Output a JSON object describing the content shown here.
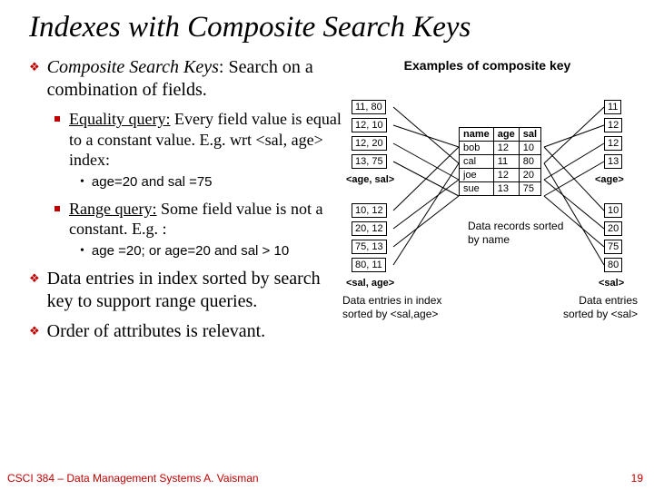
{
  "title": "Indexes with Composite Search Keys",
  "bullets": {
    "b1a_em": "Composite Search Keys",
    "b1a_rest": ": Search on a combination of fields.",
    "b2a_u": "Equality query:",
    "b2a_rest": " Every field value is equal to a constant value. E.g. wrt <sal, age> index:",
    "b3a": "age=20 and sal =75",
    "b2b_u": "Range query:",
    "b2b_rest": " Some field value is not a constant. E.g. :",
    "b3b": "age =20; or age=20 and sal > 10",
    "b1b": "Data entries in index sorted by search key to support range queries.",
    "b1c": "Order of attributes is relevant."
  },
  "right": {
    "ex_title": "Examples of composite key",
    "left_idx": [
      "11, 80",
      "12, 10",
      "12, 20",
      "13, 75"
    ],
    "left_idx_label": "<age, sal>",
    "left_idx2": [
      "10, 12",
      "20, 12",
      "75, 13",
      "80, 11"
    ],
    "left_idx2_label": "<sal, age>",
    "left_caption": "Data entries in index sorted by <sal,age>",
    "table_hdr": [
      "name",
      "age",
      "sal"
    ],
    "table_rows": [
      [
        "bob",
        "12",
        "10"
      ],
      [
        "cal",
        "11",
        "80"
      ],
      [
        "joe",
        "12",
        "20"
      ],
      [
        "sue",
        "13",
        "75"
      ]
    ],
    "table_caption": "Data records sorted by name",
    "right_idx": [
      "11",
      "12",
      "12",
      "13"
    ],
    "right_idx_label": "<age>",
    "right_idx2": [
      "10",
      "20",
      "75",
      "80"
    ],
    "right_idx2_label": "<sal>",
    "right_caption": "Data entries sorted by <sal>"
  },
  "footer": {
    "text": "CSCI 384 – Data Management Systems   A. Vaisman",
    "page": "19"
  }
}
